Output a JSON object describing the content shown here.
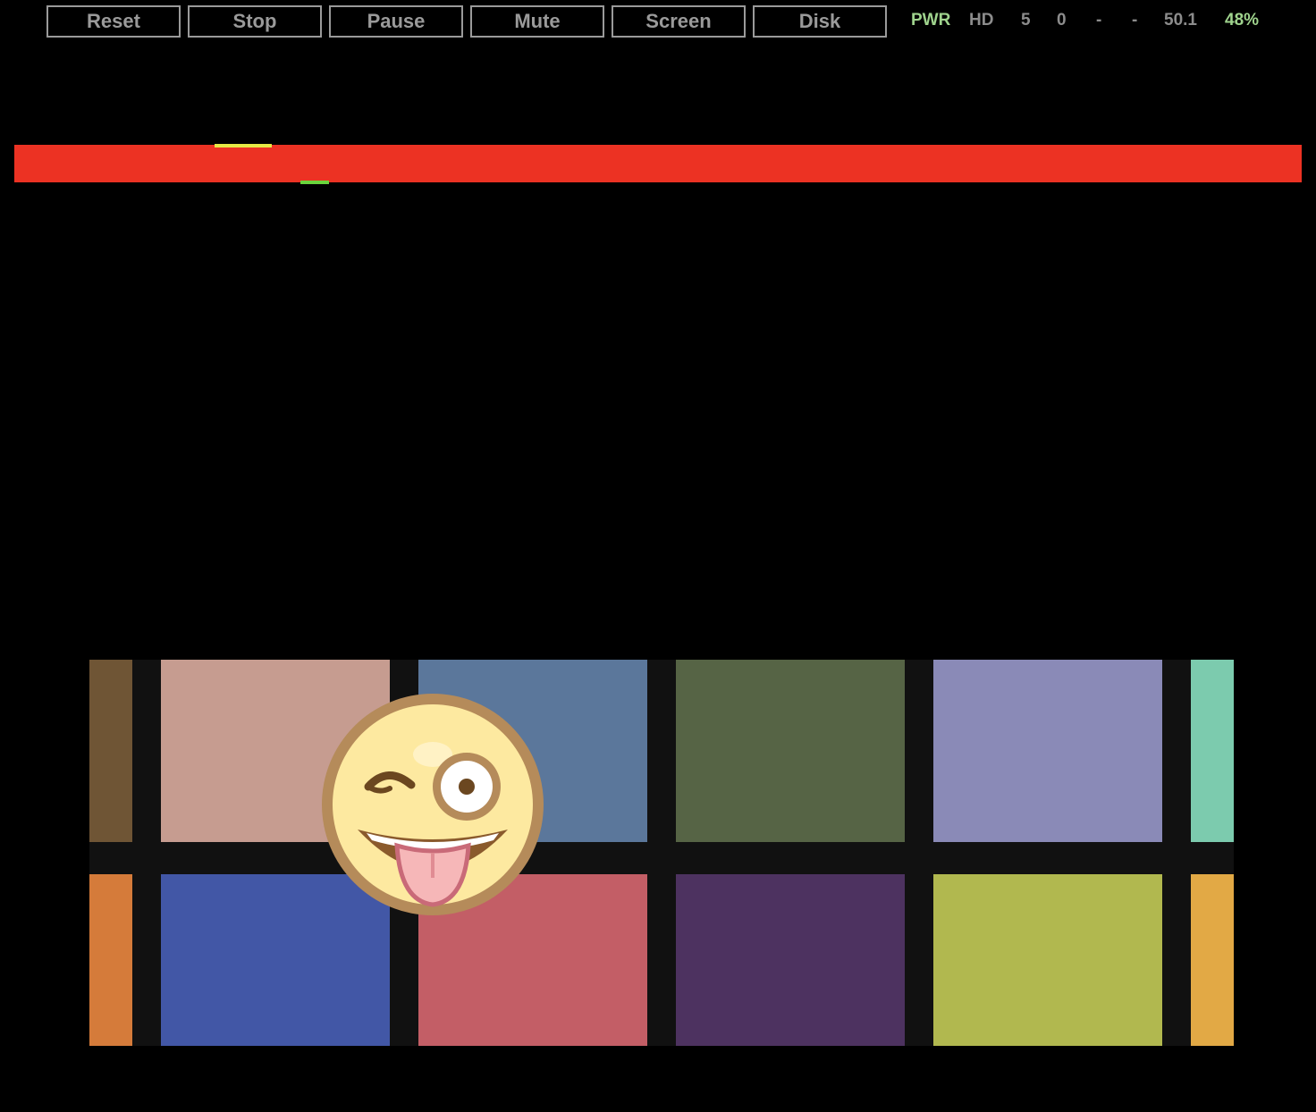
{
  "toolbar": {
    "buttons": [
      "Reset",
      "Stop",
      "Pause",
      "Mute",
      "Screen",
      "Disk"
    ]
  },
  "status": {
    "pwr": "PWR",
    "hd": "HD",
    "val_a": "5",
    "val_b": "0",
    "val_c": "-",
    "val_d": "-",
    "speed": "50.1",
    "percent": "48%"
  },
  "colors": {
    "background": "#000000",
    "button_border": "#9a9a9a",
    "status_active": "#9fd38d",
    "status_inactive": "#8c8c8c",
    "raster_bar": "#ec3223",
    "raster_yellow": "#e6e845",
    "raster_green": "#6ad43c",
    "palette_top": [
      "#6f5535",
      "#c69c90",
      "#5b779b",
      "#566445",
      "#8a8ab7",
      "#7ccbae"
    ],
    "palette_bottom": [
      "#d57b3a",
      "#4257a6",
      "#c35e66",
      "#4d3260",
      "#b1b84f",
      "#e2a945"
    ]
  },
  "sprite": {
    "icon": "winking-tongue-face-icon"
  }
}
